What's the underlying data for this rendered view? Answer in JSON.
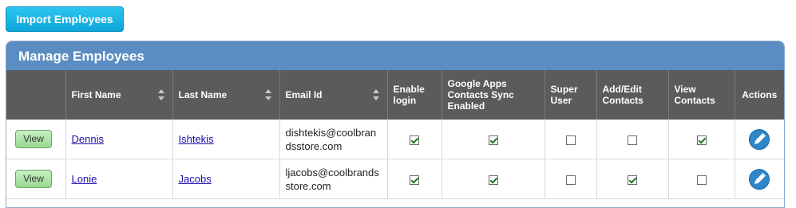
{
  "import_button": {
    "label": "Import Employees"
  },
  "panel": {
    "title": "Manage Employees"
  },
  "table": {
    "headers": {
      "first_name": "First Name",
      "last_name": "Last Name",
      "email_id": "Email Id",
      "enable_login": "Enable login",
      "google_sync": "Google Apps Contacts Sync Enabled",
      "super_user": "Super User",
      "add_edit_contacts": "Add/Edit Contacts",
      "view_contacts": "View Contacts",
      "actions": "Actions"
    },
    "rows": [
      {
        "view_label": "View",
        "first_name": "Dennis",
        "last_name": "Ishtekis",
        "email": "dishtekis@coolbrandsstore.com",
        "enable_login": true,
        "google_sync": true,
        "super_user": false,
        "add_edit_contacts": false,
        "view_contacts": true,
        "action_icon": "edit-pencil-icon"
      },
      {
        "view_label": "View",
        "first_name": "Lonie",
        "last_name": "Jacobs",
        "email": "ljacobs@coolbrandsstore.com",
        "enable_login": true,
        "google_sync": true,
        "super_user": false,
        "add_edit_contacts": true,
        "view_contacts": false,
        "action_icon": "edit-pencil-icon"
      }
    ]
  }
}
